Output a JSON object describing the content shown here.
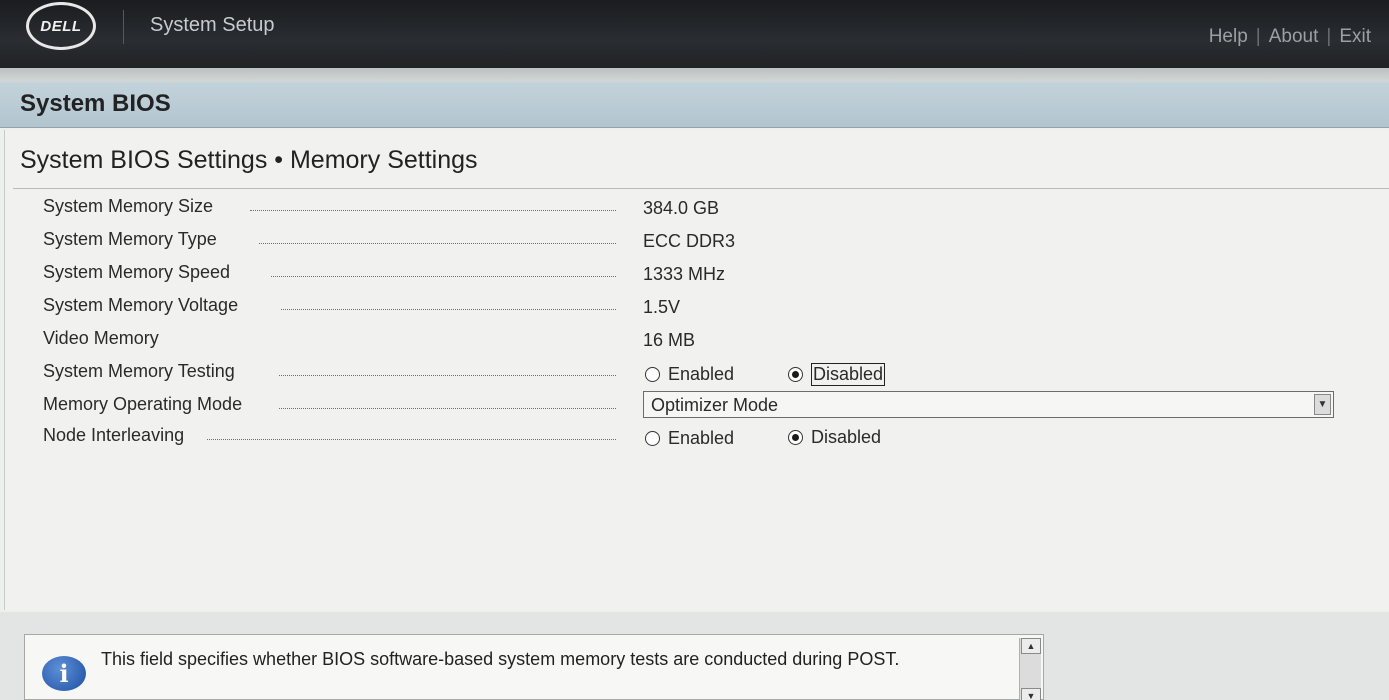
{
  "header": {
    "logo_text": "DELL",
    "app_title": "System Setup",
    "links": [
      "Help",
      "About",
      "Exit"
    ],
    "separator": "|"
  },
  "section": {
    "title": "System BIOS"
  },
  "breadcrumb": "System BIOS Settings • Memory Settings",
  "settings": {
    "memory_size": {
      "label": "System Memory Size",
      "value": "384.0 GB"
    },
    "memory_type": {
      "label": "System Memory Type",
      "value": "ECC DDR3"
    },
    "memory_speed": {
      "label": "System Memory Speed",
      "value": "1333 MHz"
    },
    "memory_voltage": {
      "label": "System Memory Voltage",
      "value": "1.5V"
    },
    "video_memory": {
      "label": "Video Memory",
      "value": "16 MB"
    },
    "memory_testing": {
      "label": "System Memory Testing",
      "option_enabled": "Enabled",
      "option_disabled": "Disabled",
      "selected": "Disabled"
    },
    "operating_mode": {
      "label": "Memory Operating Mode",
      "value": "Optimizer Mode"
    },
    "node_interleaving": {
      "label": "Node Interleaving",
      "option_enabled": "Enabled",
      "option_disabled": "Disabled",
      "selected": "Disabled"
    }
  },
  "help": {
    "icon": "info-icon",
    "text": "This field specifies whether BIOS software-based system memory tests are conducted during POST."
  }
}
